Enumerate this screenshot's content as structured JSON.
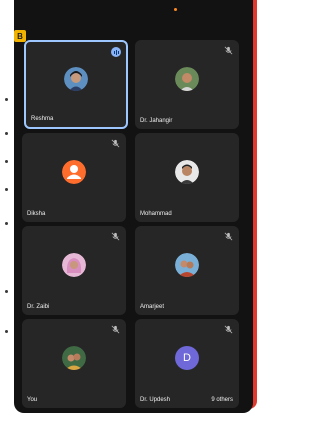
{
  "badge": "B",
  "tiles": [
    {
      "name": "Reshma",
      "state": "speaking"
    },
    {
      "name": "Dr. Jahangir",
      "state": "muted"
    },
    {
      "name": "Diksha",
      "state": "muted"
    },
    {
      "name": "Mohammad",
      "state": "unmuted"
    },
    {
      "name": "Dr. Zaibi",
      "state": "muted"
    },
    {
      "name": "Amarjeet",
      "state": "muted"
    },
    {
      "name": "You",
      "state": "muted"
    },
    {
      "name": "Dr. Updesh",
      "state": "muted",
      "initial": "D",
      "extra": "9 others"
    }
  ],
  "colors": {
    "accent_border": "#9ec7ff",
    "tile_bg": "#262626",
    "screen_bg": "#121212",
    "rail": "#e03a2f",
    "diksha_avatar": "#ff6d2d",
    "updesh_avatar": "#6e68d8"
  }
}
